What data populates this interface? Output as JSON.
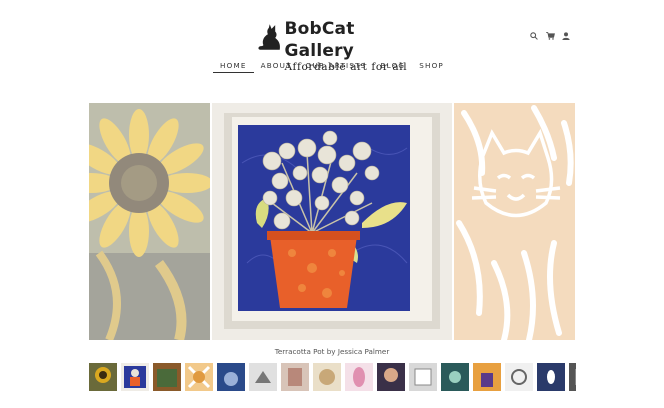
{
  "brand": {
    "title": "BobCat Gallery",
    "tagline": "Affordable art for all"
  },
  "header_icons": [
    "search-icon",
    "cart-icon",
    "user-icon"
  ],
  "nav": {
    "items": [
      {
        "label": "HOME",
        "active": true
      },
      {
        "label": "ABOUT",
        "active": false
      },
      {
        "label": "OUR ARTISTS",
        "active": false
      },
      {
        "label": "BLOG",
        "active": false
      },
      {
        "label": "SHOP",
        "active": false
      }
    ]
  },
  "gallery": {
    "caption": "Terracotta Pot by Jessica Palmer",
    "slides": [
      "sunflower-painting",
      "terracotta-pot-painting",
      "cat-woodcut-print"
    ],
    "thumbnail_count": 16
  },
  "colors": {
    "accent_cat_bg": "#f3d8b8",
    "painting_blue": "#2b3a9c",
    "pot_orange": "#e8602a"
  }
}
